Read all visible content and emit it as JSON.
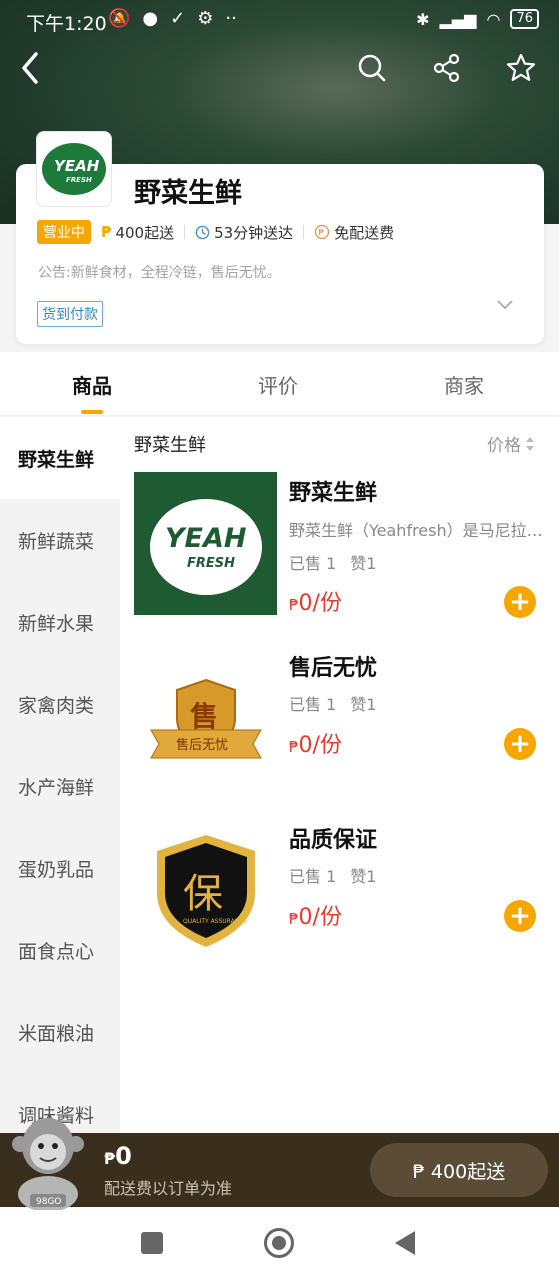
{
  "status_bar": {
    "time": "下午1:20",
    "battery": "76"
  },
  "store": {
    "name": "野菜生鲜",
    "status_badge": "营业中",
    "min_order": "400起送",
    "delivery_time": "53分钟送达",
    "delivery_fee": "免配送费",
    "notice": "公告:新鲜食材，全程冷链，售后无忧。",
    "payment_tag": "货到付款",
    "logo_text_line1": "YEAH",
    "logo_text_line2": "FRESH"
  },
  "tabs": [
    {
      "label": "商品",
      "active": true
    },
    {
      "label": "评价",
      "active": false
    },
    {
      "label": "商家",
      "active": false
    }
  ],
  "categories": [
    {
      "label": "野菜生鲜",
      "active": true
    },
    {
      "label": "新鲜蔬菜",
      "active": false
    },
    {
      "label": "新鲜水果",
      "active": false
    },
    {
      "label": "家禽肉类",
      "active": false
    },
    {
      "label": "水产海鲜",
      "active": false
    },
    {
      "label": "蛋奶乳品",
      "active": false
    },
    {
      "label": "面食点心",
      "active": false
    },
    {
      "label": "米面粮油",
      "active": false
    },
    {
      "label": "调味酱料",
      "active": false
    }
  ],
  "list": {
    "section_title": "野菜生鲜",
    "sort_label": "价格"
  },
  "products": [
    {
      "name": "野菜生鲜",
      "desc": "野菜生鲜（Yeahfresh）是马尼拉的生鲜平台",
      "sold": "已售 1",
      "likes": "赞1",
      "currency": "₱",
      "price": "0/份",
      "image": "yeahfresh-logo"
    },
    {
      "name": "售后无忧",
      "desc": "",
      "sold": "已售 1",
      "likes": "赞1",
      "currency": "₱",
      "price": "0/份",
      "image": "after-sales-badge",
      "badge_char": "售",
      "badge_ribbon": "售后无忧"
    },
    {
      "name": "品质保证",
      "desc": "",
      "sold": "已售 1",
      "likes": "赞1",
      "currency": "₱",
      "price": "0/份",
      "image": "quality-shield",
      "badge_char": "保",
      "badge_sub": "QUALITY ASSURANCE"
    }
  ],
  "cart": {
    "currency": "₱",
    "total": "0",
    "note": "配送费以订单为准",
    "checkout_label": "₱ 400起送",
    "mascot_tag": "98GO"
  },
  "colors": {
    "accent": "#f7a600",
    "price": "#e8392a",
    "brand_green": "#1e5b33",
    "cart_bar": "#3a2f1d"
  }
}
